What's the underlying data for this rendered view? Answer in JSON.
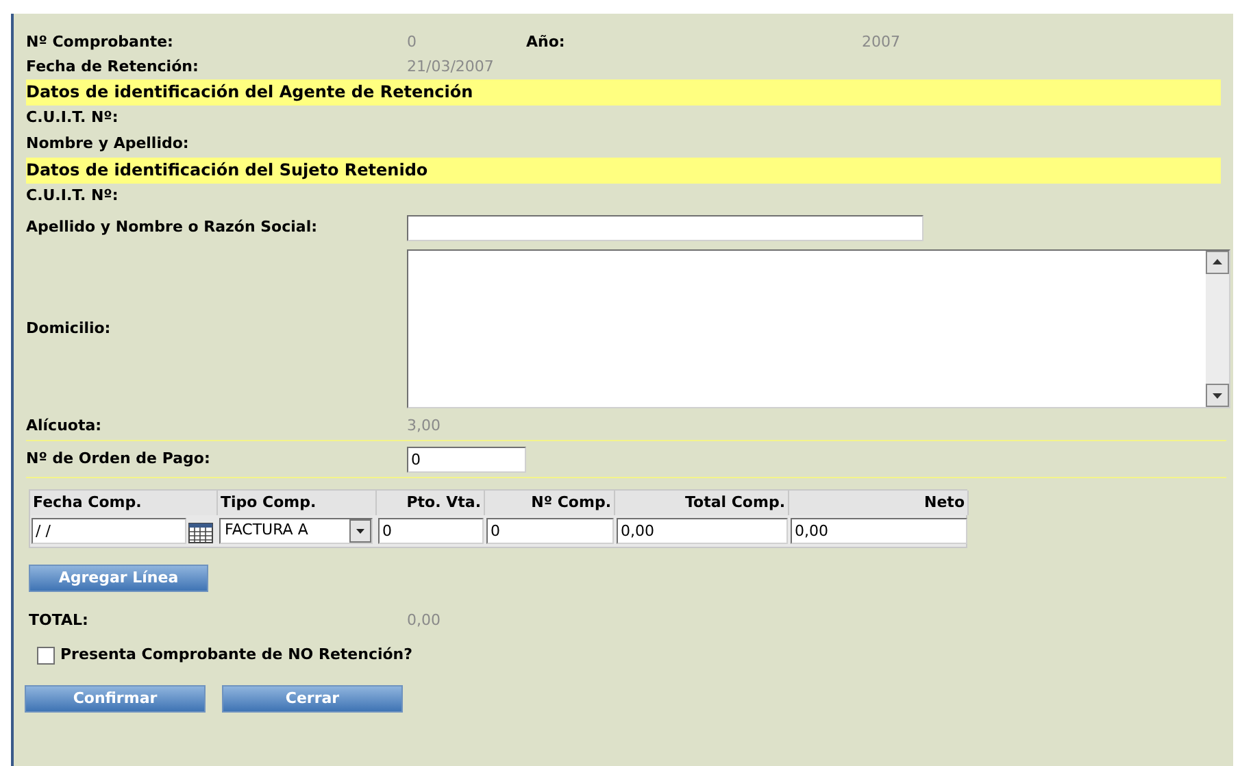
{
  "header": {
    "comprobante_label": "Nº Comprobante:",
    "comprobante_value": "0",
    "anio_label": "Año:",
    "anio_value": "2007",
    "fecha_label": "Fecha de Retención:",
    "fecha_value": "21/03/2007"
  },
  "rows": [
    {
      "kind": "band",
      "title": "Datos de identificación del Agente de Retención"
    },
    {
      "kind": "label",
      "label": "C.U.I.T. Nº:"
    },
    {
      "kind": "label",
      "label": "Nombre y Apellido:"
    },
    {
      "kind": "band",
      "title": "Datos de identificación del Sujeto Retenido"
    },
    {
      "kind": "label",
      "label": "C.U.I.T. Nº:"
    },
    {
      "kind": "input",
      "label": "Apellido y Nombre o Razón Social:"
    },
    {
      "kind": "textarea",
      "label": "Domicilio:"
    },
    {
      "kind": "value",
      "label": "Alícuota:",
      "value": "3,00"
    },
    {
      "kind": "short_input",
      "label": "Nº de Orden de Pago:",
      "value": "0"
    }
  ],
  "table": {
    "columns": [
      "Fecha Comp.",
      "Tipo Comp.",
      "Pto. Vta.",
      "Nº Comp.",
      "Total Comp.",
      "Neto"
    ],
    "row": {
      "fecha": "/ /",
      "tipo": "FACTURA A",
      "pto": "0",
      "numero": "0",
      "total": "0,00",
      "neto": "0,00"
    }
  },
  "add_button": "Agregar Línea",
  "total": {
    "label": "TOTAL:",
    "value": "0,00"
  },
  "no_retencion": {
    "label": "Presenta Comprobante de NO Retención?",
    "checked": false
  },
  "buttons": [
    "Confirmar",
    "Cerrar"
  ]
}
